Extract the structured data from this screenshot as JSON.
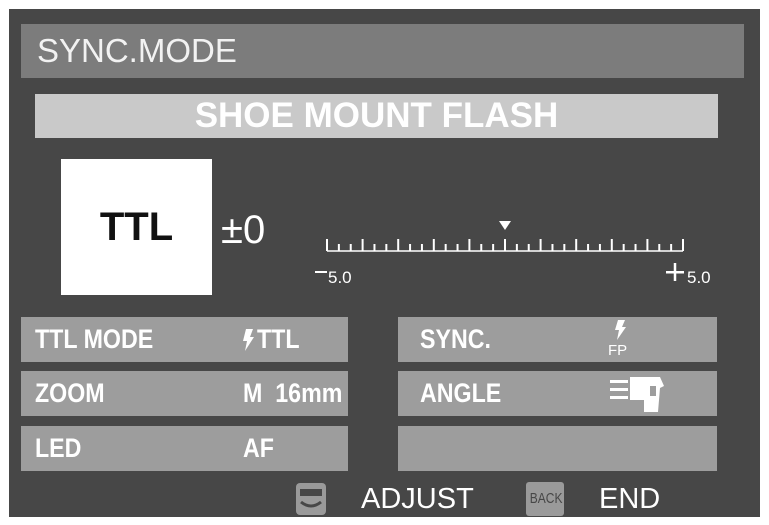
{
  "header": {
    "title": "SYNC.MODE"
  },
  "banner": {
    "text": "SHOE MOUNT FLASH"
  },
  "flash_mode": {
    "value": "TTL"
  },
  "compensation": {
    "value": "±0",
    "scale_min_label": "5.0",
    "scale_max_label": "5.0",
    "min": -5.0,
    "max": 5.0,
    "current": 0
  },
  "left_rows": [
    {
      "label": "TTL MODE",
      "value": "TTL",
      "icon": "flash-bolt-icon"
    },
    {
      "label": "ZOOM",
      "value": "M  16mm"
    },
    {
      "label": "LED",
      "value": "AF"
    }
  ],
  "right_rows": [
    {
      "label": "SYNC.",
      "value": "FP",
      "icon": "flash-fp-icon"
    },
    {
      "label": "ANGLE",
      "icon": "flash-angle-icon"
    },
    {
      "label": ""
    }
  ],
  "footer": {
    "adjust_label": "ADJUST",
    "back_key": "BACK",
    "end_label": "END",
    "adjust_icon": "rear-dial-icon"
  },
  "colors": {
    "screen_bg": "#474747",
    "header_bg": "#7c7c7c",
    "banner_bg": "#c9c9c9",
    "row_bg": "#9d9d9d"
  }
}
